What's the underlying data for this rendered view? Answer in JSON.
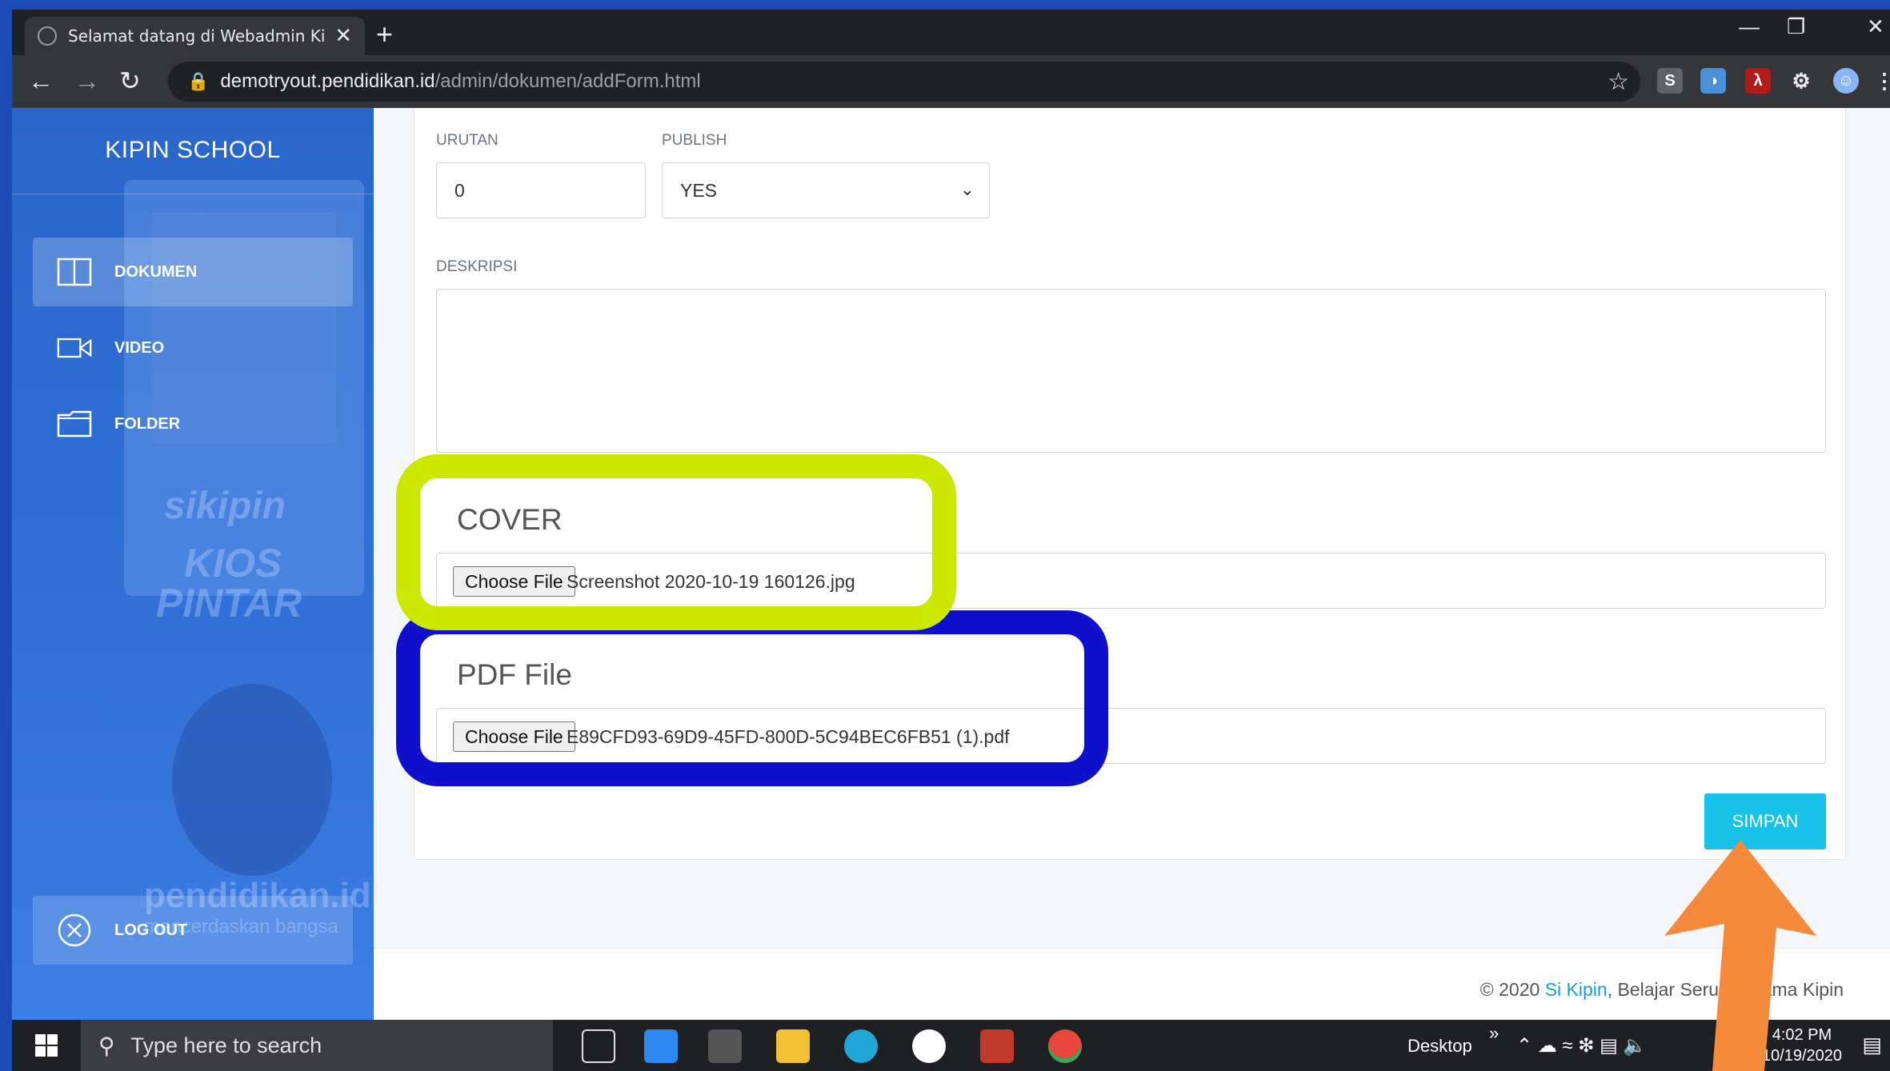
{
  "browser": {
    "tab_title": "Selamat datang di Webadmin Kipin",
    "tab_close": "✕",
    "new_tab": "+",
    "url_host": "demotryout.pendidikan.id",
    "url_path": "/admin/dokumen/addForm.html",
    "controls": {
      "minimize": "—",
      "restore": "❐",
      "close": "✕"
    }
  },
  "sidebar": {
    "brand": "KIPIN SCHOOL",
    "items": [
      {
        "label": "DOKUMEN",
        "icon": "book-icon"
      },
      {
        "label": "VIDEO",
        "icon": "video-camera-icon"
      },
      {
        "label": "FOLDER",
        "icon": "folder-icon"
      }
    ],
    "logout": {
      "label": "LOG OUT",
      "icon": "close-circle-icon"
    },
    "art": {
      "sikipin": "sikipin",
      "kios": "KIOS",
      "pintar": "PINTAR",
      "pendidikan": "pendidikan.id",
      "tagline": "mencerdaskan bangsa"
    }
  },
  "form": {
    "urutan": {
      "label": "URUTAN",
      "value": "0"
    },
    "publish": {
      "label": "PUBLISH",
      "value": "YES"
    },
    "deskripsi": {
      "label": "DESKRIPSI",
      "value": ""
    },
    "cover": {
      "label": "COVER",
      "button": "Choose File",
      "file": "Screenshot 2020-10-19 160126.jpg"
    },
    "pdf": {
      "label": "PDF File",
      "button": "Choose File",
      "file": "E89CFD93-69D9-45FD-800D-5C94BEC6FB51 (1).pdf"
    },
    "submit": "SIMPAN"
  },
  "footer": {
    "prefix": "© 2020 ",
    "link": "Si Kipin",
    "suffix": ", Belajar Seru Bersama Kipin"
  },
  "taskbar": {
    "search_placeholder": "Type here to search",
    "desktop_label": "Desktop",
    "chevron": "»",
    "time": "4:02 PM",
    "date": "10/19/2020"
  },
  "colors": {
    "highlight_cover": "#cce800",
    "highlight_pdf": "#1010cc",
    "annotation_arrow": "#f58a3c",
    "submit_button": "#17c1e8"
  }
}
